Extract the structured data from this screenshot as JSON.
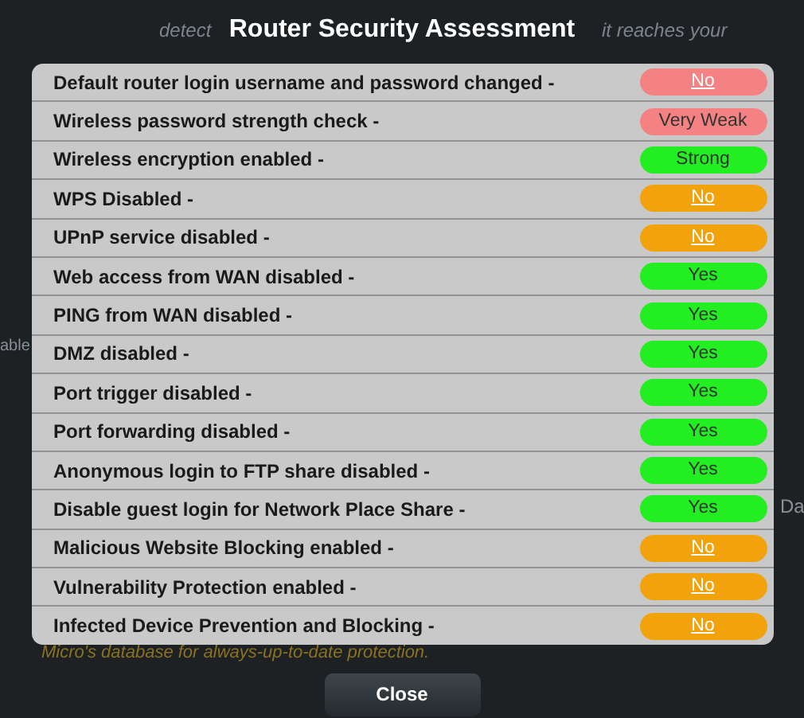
{
  "background_texts": [
    {
      "text": "detect",
      "kind": "top-left"
    },
    {
      "text": "it reaches your",
      "kind": "top-right"
    },
    {
      "text": "able",
      "kind": "side-left"
    },
    {
      "text": "Da",
      "kind": "side-right"
    },
    {
      "text": "Micro's database for always-up-to-date protection.",
      "kind": "bottom"
    }
  ],
  "dialog": {
    "title": "Router Security Assessment",
    "checks": [
      {
        "label": "Default router login username and password changed -",
        "status": "No",
        "kind": "link",
        "color": "#f58282"
      },
      {
        "label": "Wireless password strength check -",
        "status": "Very Weak",
        "kind": "text",
        "color": "#f58282"
      },
      {
        "label": "Wireless encryption enabled -",
        "status": "Strong",
        "kind": "text",
        "color": "#22ee22"
      },
      {
        "label": "WPS Disabled -",
        "status": "No",
        "kind": "link",
        "color": "#f2a30c"
      },
      {
        "label": "UPnP service disabled -",
        "status": "No",
        "kind": "link",
        "color": "#f2a30c"
      },
      {
        "label": "Web access from WAN disabled -",
        "status": "Yes",
        "kind": "text",
        "color": "#22ee22"
      },
      {
        "label": "PING from WAN disabled -",
        "status": "Yes",
        "kind": "text",
        "color": "#22ee22"
      },
      {
        "label": "DMZ disabled -",
        "status": "Yes",
        "kind": "text",
        "color": "#22ee22"
      },
      {
        "label": "Port trigger disabled -",
        "status": "Yes",
        "kind": "text",
        "color": "#22ee22"
      },
      {
        "label": "Port forwarding disabled -",
        "status": "Yes",
        "kind": "text",
        "color": "#22ee22"
      },
      {
        "label": "Anonymous login to FTP share disabled -",
        "status": "Yes",
        "kind": "text",
        "color": "#22ee22"
      },
      {
        "label": "Disable guest login for Network Place Share -",
        "status": "Yes",
        "kind": "text",
        "color": "#22ee22"
      },
      {
        "label": "Malicious Website Blocking enabled -",
        "status": "No",
        "kind": "link",
        "color": "#f2a30c"
      },
      {
        "label": "Vulnerability Protection enabled -",
        "status": "No",
        "kind": "link",
        "color": "#f2a30c"
      },
      {
        "label": "Infected Device Prevention and Blocking -",
        "status": "No",
        "kind": "link",
        "color": "#f2a30c"
      }
    ],
    "close_button": "Close"
  }
}
